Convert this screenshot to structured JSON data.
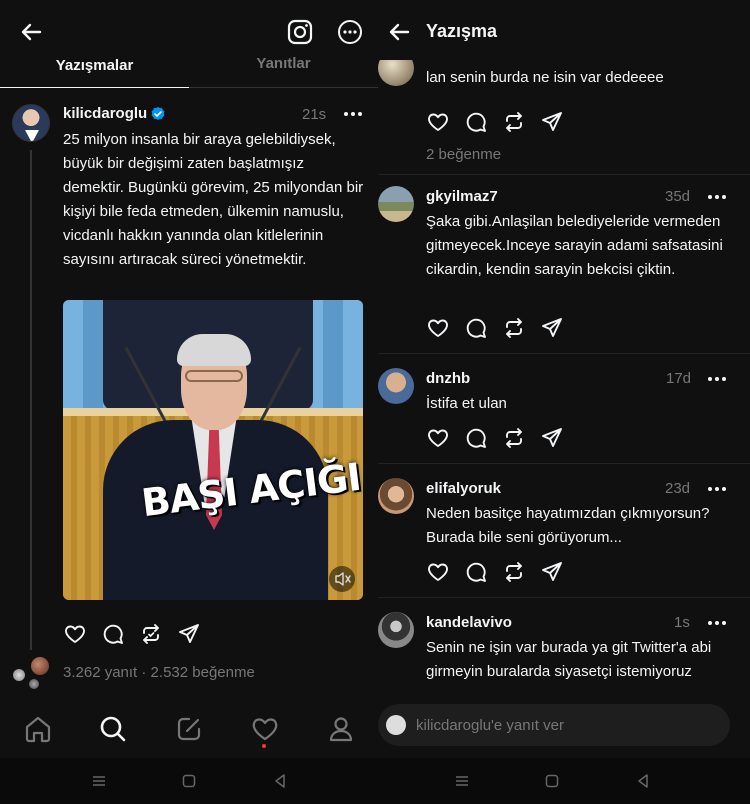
{
  "left": {
    "tabs": {
      "active": "Yazışmalar",
      "inactive": "Yanıtlar"
    },
    "post": {
      "username": "kilicdaroglu",
      "time": "21s",
      "text": "25 milyon insanla bir araya gelebildiysek, büyük bir değişimi zaten başlatmışız demektir. Bugünkü görevim, 25 milyondan bir kişiyi bile feda etmeden, ülkemin namuslu, vicdanlı hakkın yanında olan kitlelerinin sayısını artıracak süreci yönetmektir.",
      "image_caption": "BAŞI AÇIĞI",
      "stats": "3.262 yanıt · 2.532 beğenme"
    },
    "icons": [
      "back-arrow-icon",
      "instagram-icon",
      "more-circle-icon",
      "verified-icon",
      "heart-icon",
      "comment-icon",
      "repost-icon",
      "share-icon",
      "mute-icon"
    ],
    "nav": [
      "home-icon",
      "search-icon",
      "compose-icon",
      "activity-heart-icon",
      "profile-icon"
    ]
  },
  "right": {
    "title": "Yazışma",
    "comments": [
      {
        "username": "",
        "time": "",
        "text": "lan senin burda ne isin var dedeeee",
        "likes": "2 beğenme"
      },
      {
        "username": "gkyilmaz7",
        "time": "35d",
        "text": "Şaka gibi.Anlaşilan belediyeleride vermeden gitmeyecek.Inceye sarayin adami safsatasini cikardin, kendin sarayin bekcisi çiktin.",
        "likes": ""
      },
      {
        "username": "dnzhb",
        "time": "17d",
        "text": "İstifa et ulan",
        "likes": ""
      },
      {
        "username": "elifalyoruk",
        "time": "23d",
        "text": "Neden basitçe hayatımızdan çıkmıyorsun? Burada bile seni görüyorum...",
        "likes": ""
      },
      {
        "username": "kandelavivo",
        "time": "1s",
        "text": "Senin ne işin var burada ya git Twitter'a abi girmeyin buralarda siyasetçi istemiyoruz",
        "likes": ""
      }
    ],
    "reply_placeholder": "kilicdaroglu'e yanıt ver"
  },
  "colors": {
    "background": "#101010",
    "text": "#f3f5f7",
    "muted": "#777777",
    "verified": "#0095f6",
    "notify": "#ff3040"
  }
}
